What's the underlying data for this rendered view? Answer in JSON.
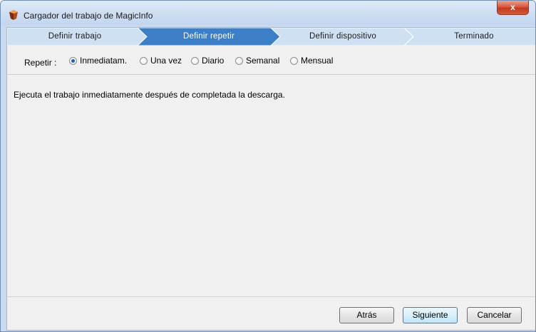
{
  "window": {
    "title": "Cargador del trabajo de MagicInfo",
    "close_label": "x"
  },
  "steps": [
    {
      "label": "Definir trabajo",
      "active": false
    },
    {
      "label": "Definir repetir",
      "active": true
    },
    {
      "label": "Definir dispositivo",
      "active": false
    },
    {
      "label": "Terminado",
      "active": false
    }
  ],
  "repeat": {
    "label": "Repetir :",
    "options": [
      {
        "label": "Inmediatam.",
        "checked": true
      },
      {
        "label": "Una vez",
        "checked": false
      },
      {
        "label": "Diario",
        "checked": false
      },
      {
        "label": "Semanal",
        "checked": false
      },
      {
        "label": "Mensual",
        "checked": false
      }
    ]
  },
  "description": "Ejecuta el trabajo inmediatamente después de completada la descarga.",
  "buttons": {
    "back": "Atrás",
    "next": "Siguiente",
    "cancel": "Cancelar"
  },
  "colors": {
    "step_active": "#3d7fc6",
    "step_inactive": "#cfe0f3",
    "radio_checked": "#1f5fb0"
  }
}
